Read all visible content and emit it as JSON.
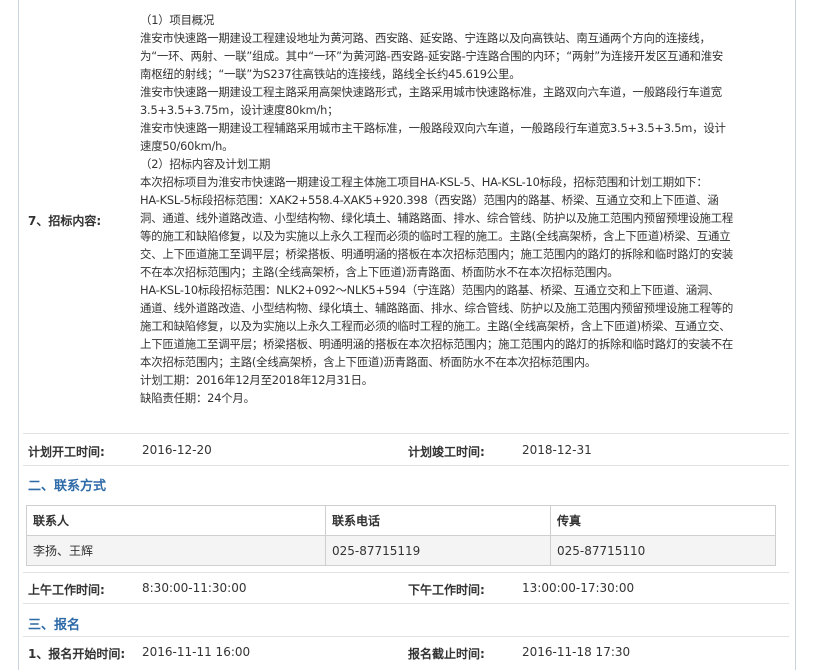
{
  "bid_content": {
    "label": "7、招标内容:",
    "lines": [
      "（1）项目概况",
      "淮安市快速路一期建设工程建设地址为黄河路、西安路、延安路、宁连路以及向高铁站、南互通两个方向的连接线，",
      "为“一环、两射、一联”组成。其中“一环”为黄河路-西安路-延安路-宁连路合围的内环；“两射”为连接开发区互通和淮安",
      "南枢纽的射线；“一联”为S237往高铁站的连接线，路线全长约45.619公里。",
      "淮安市快速路一期建设工程主路采用高架快速路形式，主路采用城市快速路标准，主路双向六车道，一般路段行车道宽",
      "3.5+3.5+3.75m，设计速度80km/h；",
      "淮安市快速路一期建设工程辅路采用城市主干路标准，一般路段双向六车道，一般路段行车道宽3.5+3.5+3.5m，设计",
      "速度50/60km/h。",
      "（2）招标内容及计划工期",
      "本次招标项目为淮安市快速路一期建设工程主体施工项目HA-KSL-5、HA-KSL-10标段，招标范围和计划工期如下：",
      "HA-KSL-5标段招标范围：XAK2+558.4-XAK5+920.398（西安路）范围内的路基、桥梁、互通立交和上下匝道、涵",
      "洞、通道、线外道路改造、小型结构物、绿化填土、辅路路面、排水、综合管线、防护以及施工范围内预留预埋设施工程",
      "等的施工和缺陷修复，以及为实施以上永久工程而必须的临时工程的施工。主路(全线高架桥，含上下匝道)桥梁、互通立",
      "交、上下匝道施工至调平层；桥梁搭板、明通明涵的搭板在本次招标范围内；施工范围内的路灯的拆除和临时路灯的安装",
      "不在本次招标范围内；主路(全线高架桥，含上下匝道)沥青路面、桥面防水不在本次招标范围内。",
      "HA-KSL-10标段招标范围：NLK2+092～NLK5+594（宁连路）范围内的路基、桥梁、互通立交和上下匝道、涵洞、",
      "通道、线外道路改造、小型结构物、绿化填土、辅路路面、排水、综合管线、防护以及施工范围内预留预埋设施工程等的",
      "施工和缺陷修复，以及为实施以上永久工程而必须的临时工程的施工。主路(全线高架桥，含上下匝道)桥梁、互通立交、",
      "上下匝道施工至调平层；桥梁搭板、明通明涵的搭板在本次招标范围内；施工范围内的路灯的拆除和临时路灯的安装不在",
      "本次招标范围内；主路(全线高架桥，含上下匝道)沥青路面、桥面防水不在本次招标范围内。",
      "计划工期：2016年12月至2018年12月31日。",
      "缺陷责任期：24个月。"
    ]
  },
  "schedule": {
    "start_label": "计划开工时间:",
    "start_value": "2016-12-20",
    "end_label": "计划竣工时间:",
    "end_value": "2018-12-31"
  },
  "contact_section": {
    "title": "二、联系方式",
    "headers": [
      "联系人",
      "联系电话",
      "传真"
    ],
    "row": [
      "李扬、王辉",
      "025-87715119",
      "025-87715110"
    ]
  },
  "work_hours": {
    "am_label": "上午工作时间:",
    "am_value": "8:30:00-11:30:00",
    "pm_label": "下午工作时间:",
    "pm_value": "13:00:00-17:30:00"
  },
  "signup_section": {
    "title": "三、报名",
    "start_label": "1、报名开始时间:",
    "start_value": "2016-11-11 16:00",
    "end_label": "报名截止时间:",
    "end_value": "2016-11-18 17:30"
  }
}
